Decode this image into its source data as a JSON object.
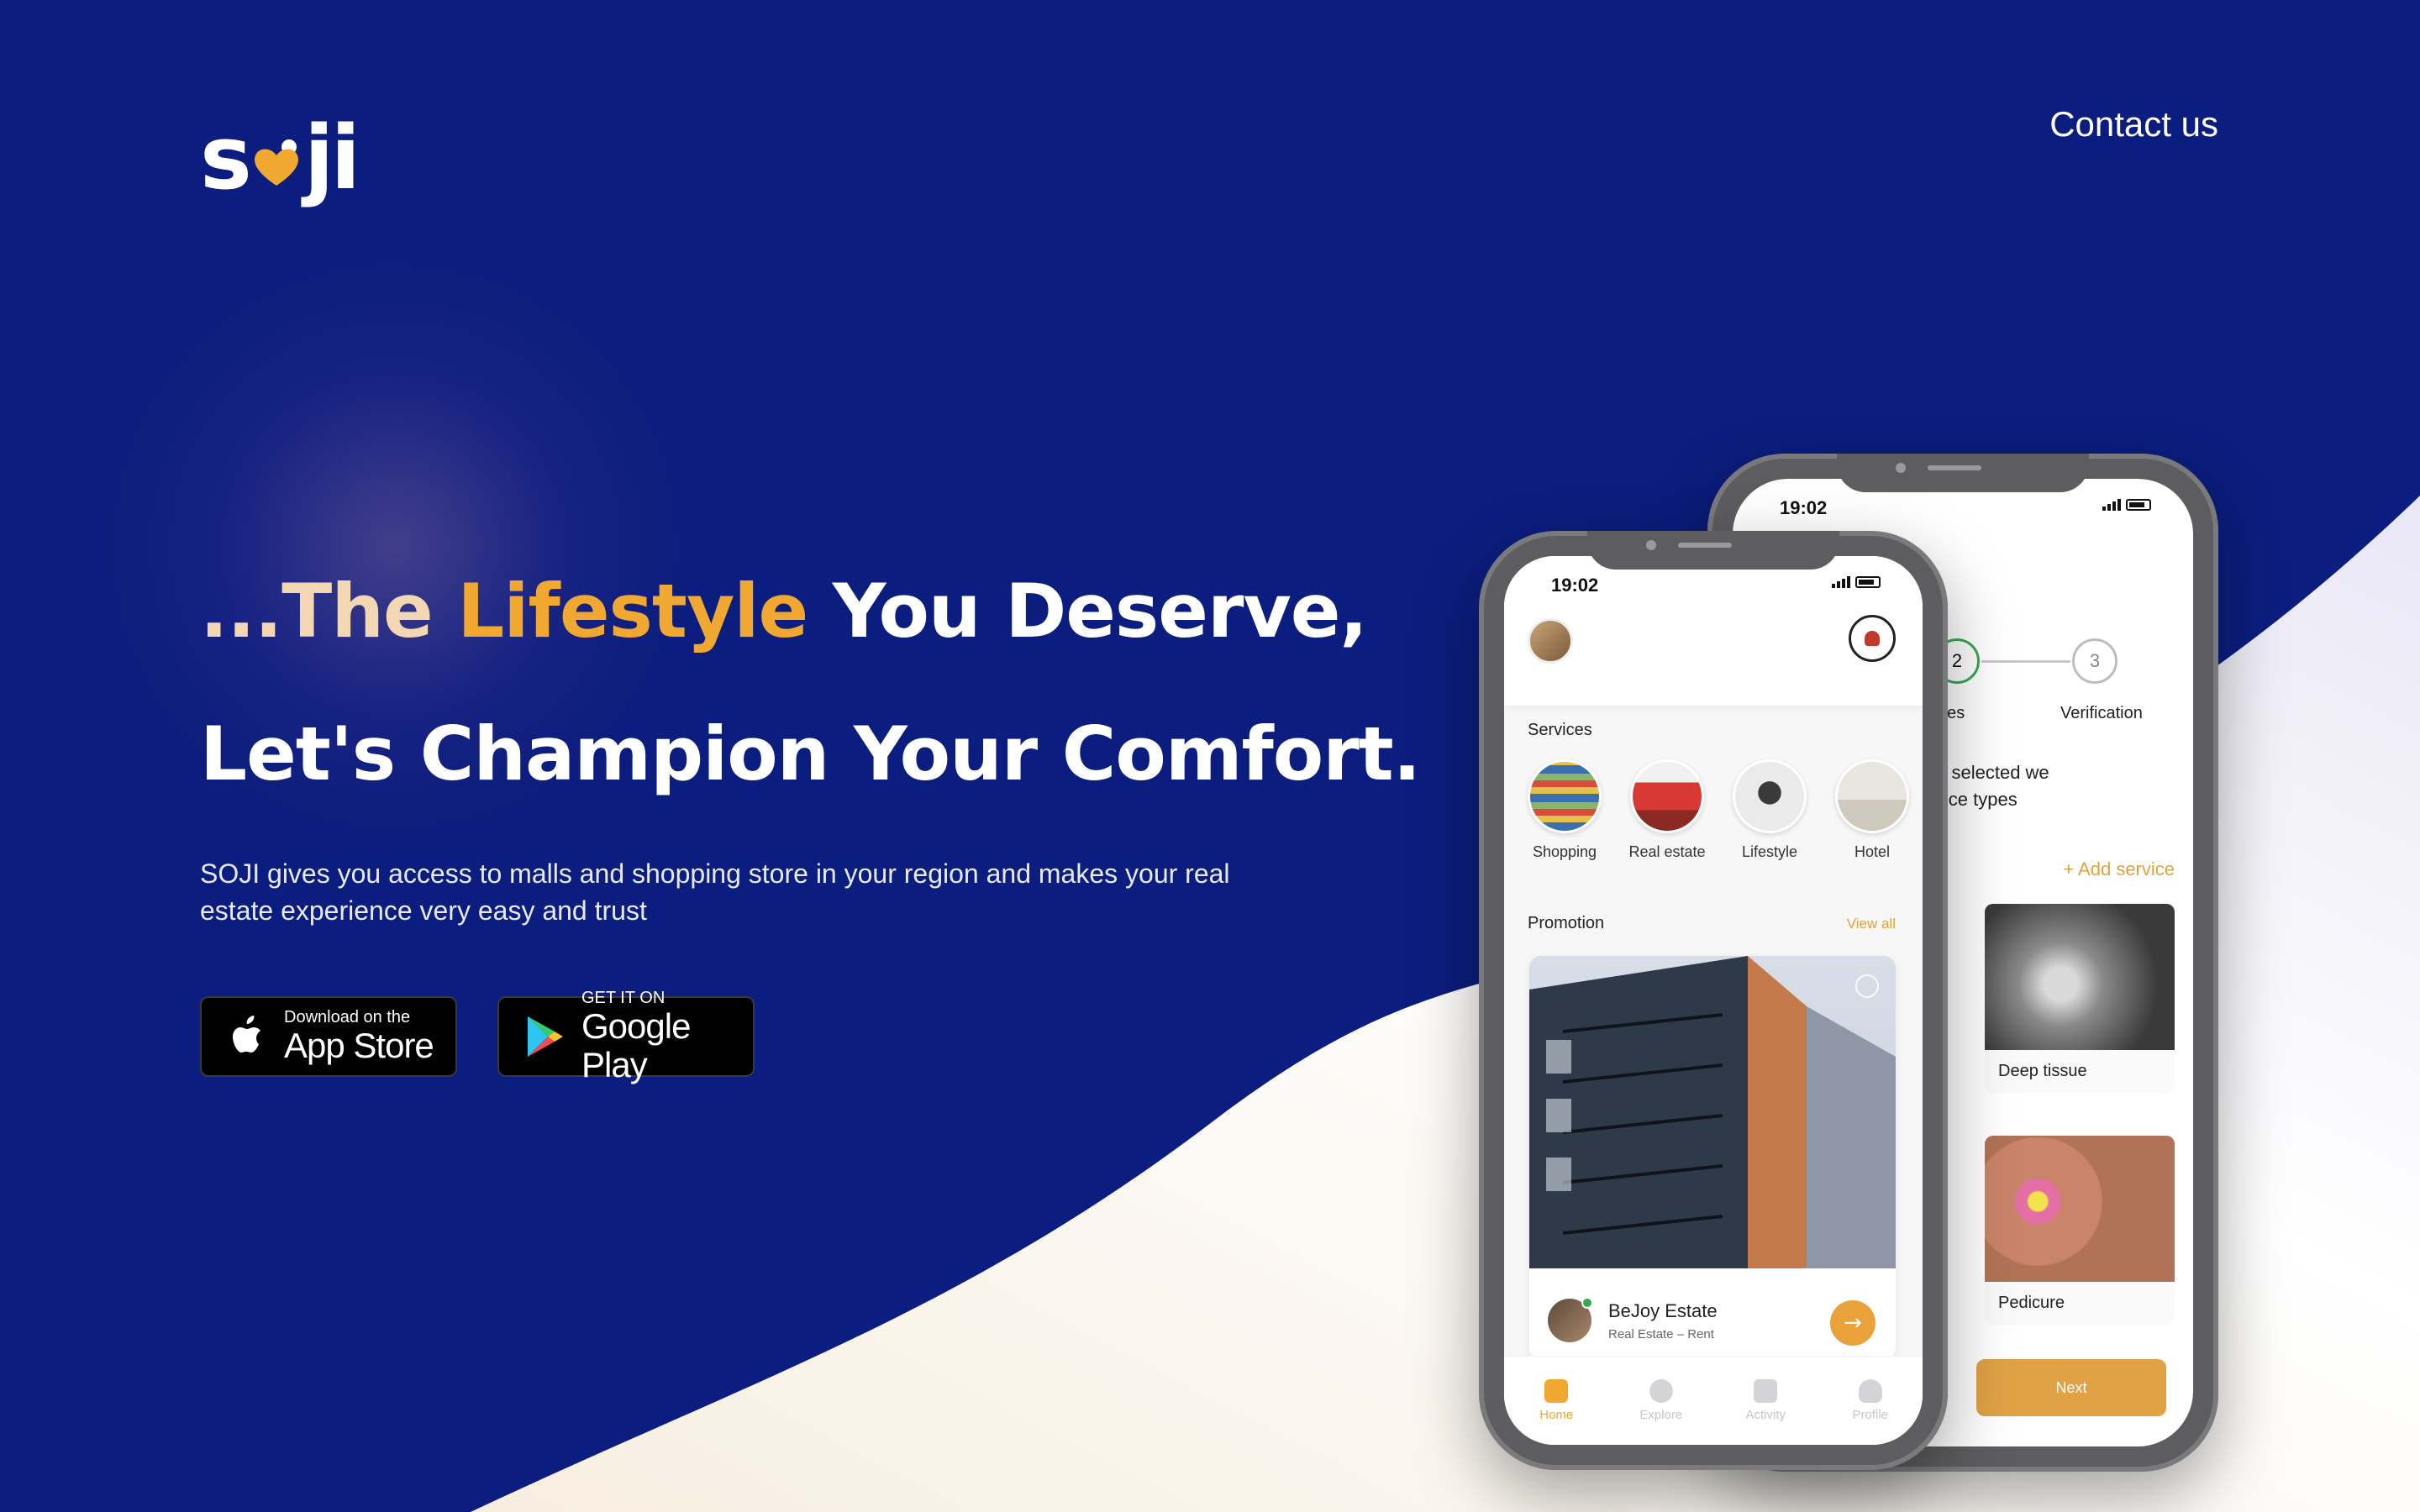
{
  "brand": {
    "logo_text_left": "s",
    "logo_text_right": "ji",
    "logo_heart_color": "#f0a830"
  },
  "nav": {
    "contact": "Contact us"
  },
  "hero": {
    "line1_lead": "...The ",
    "line1_accent": "Lifestyle",
    "line1_rest": " You Deserve,",
    "line2": "Let's Champion Your Comfort.",
    "description": "SOJI gives you access to malls and shopping store in your region and makes your real estate experience very easy and trust"
  },
  "badges": {
    "apple": {
      "small": "Download on the",
      "big": "App Store",
      "icon": "apple-icon"
    },
    "google": {
      "small": "GET IT ON",
      "big": "Google Play",
      "icon": "google-play-icon"
    }
  },
  "back_phone": {
    "time": "19:02",
    "steps": [
      {
        "number": "2",
        "label": "rvices",
        "state": "active"
      },
      {
        "number": "3",
        "label": "Verification",
        "state": "pending"
      }
    ],
    "intro_text": "gory you selected we\nfew service types",
    "add_service": "+ Add service",
    "services": [
      {
        "label": "Deep tissue"
      },
      {
        "label": "Pedicure"
      }
    ],
    "next_button": "Next"
  },
  "front_phone": {
    "time": "19:02",
    "services_title": "Services",
    "services": [
      {
        "label": "Shopping"
      },
      {
        "label": "Real estate"
      },
      {
        "label": "Lifestyle"
      },
      {
        "label": "Hotel"
      }
    ],
    "promotion_title": "Promotion",
    "view_all": "View all",
    "promo": {
      "name": "BeJoy Estate",
      "sub": "Real Estate – Rent"
    },
    "tabs": [
      {
        "label": "Home",
        "active": true
      },
      {
        "label": "Explore",
        "active": false
      },
      {
        "label": "Activity",
        "active": false
      },
      {
        "label": "Profile",
        "active": false
      }
    ]
  },
  "colors": {
    "background": "#0b1d7e",
    "accent": "#f0a830",
    "lead": "#f2d7b2",
    "wave": "#fbf6ef"
  }
}
